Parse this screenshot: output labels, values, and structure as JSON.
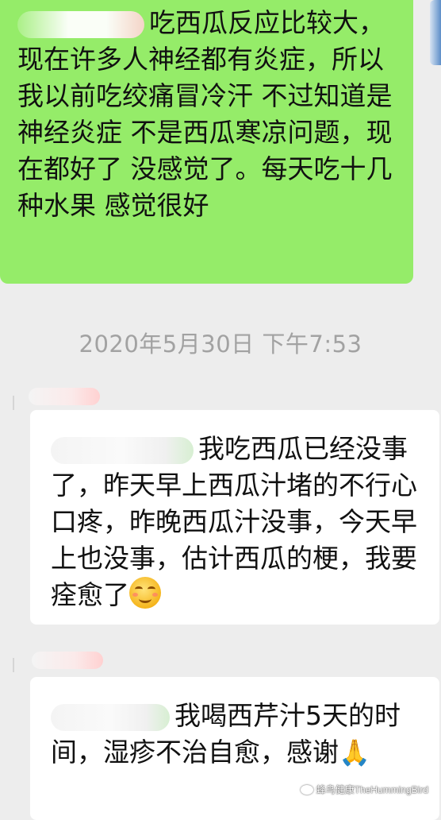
{
  "messages": [
    {
      "text": "吃西瓜反应比较大，现在许多人神经都有炎症，所以我以前吃绞痛冒冷汗 不过知道是神经炎症 不是西瓜寒凉问题，现在都好了 没感觉了。每天吃十几种水果 感觉很好"
    },
    {
      "text": "我吃西瓜已经没事了，昨天早上西瓜汁堵的不行心口疼，昨晚西瓜汁没事，今天早上也没事，估计西瓜的梗，我要痊愈了"
    },
    {
      "text": "我喝西芹汁5天的时间，湿疹不治自愈，感谢"
    }
  ],
  "timestamp": "2020年5月30日 下午7:53",
  "emojis": {
    "smile": "smirk-face-icon",
    "pray": "🙏"
  },
  "watermark": "蜂鸟健康TheHummingBird",
  "colors": {
    "outgoing_bubble": "#95ec69",
    "incoming_bubble": "#ffffff",
    "background": "#ededed",
    "timestamp": "#a2a2a2"
  }
}
